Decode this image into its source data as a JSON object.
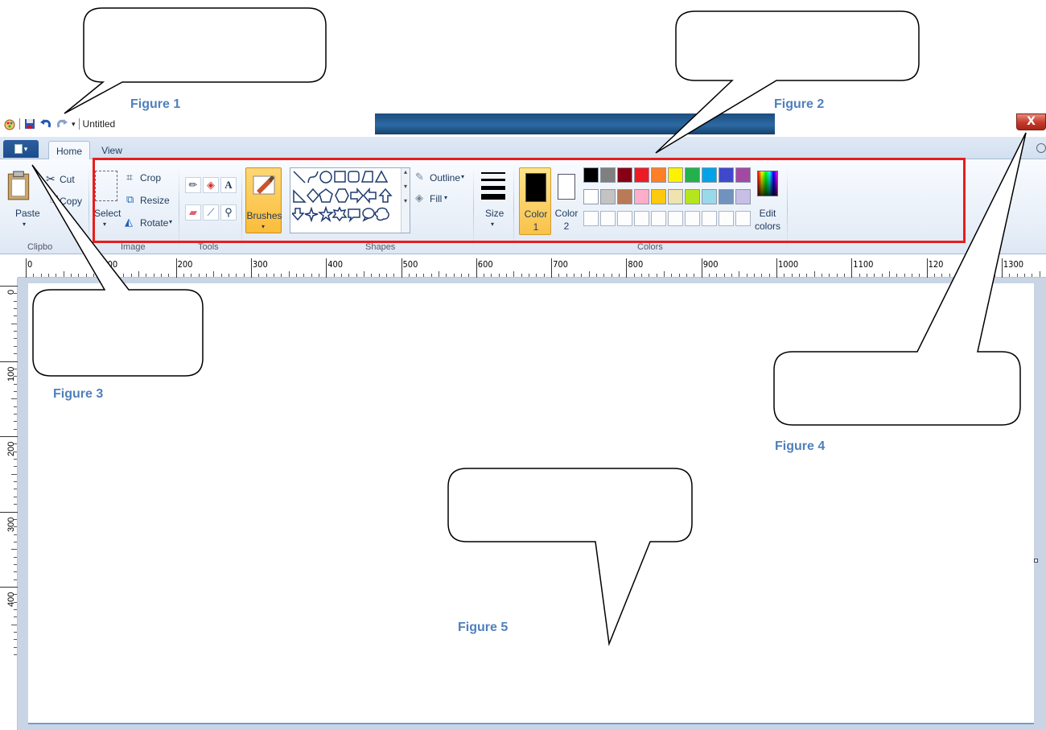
{
  "window": {
    "title_fragment": "Untitled",
    "close_label": "X"
  },
  "tabs": [
    {
      "label": "Home"
    },
    {
      "label": "View"
    }
  ],
  "ribbon": {
    "clipboard": {
      "group_label": "Clipbo",
      "paste": "Paste",
      "cut": "Cut",
      "copy": "Copy"
    },
    "image": {
      "group_label": "Image",
      "select": "Select",
      "crop": "Crop",
      "resize": "Resize",
      "rotate": "Rotate"
    },
    "tools": {
      "group_label": "Tools"
    },
    "brushes": {
      "label": "Brushes"
    },
    "shapes": {
      "group_label": "Shapes",
      "outline": "Outline",
      "fill": "Fill"
    },
    "size": {
      "label": "Size"
    },
    "colors": {
      "group_label": "Colors",
      "color1_line1": "Color",
      "color1_line2": "1",
      "color2_line1": "Color",
      "color2_line2": "2",
      "edit_line1": "Edit",
      "edit_line2": "colors",
      "row1": [
        "#000000",
        "#7f7f7f",
        "#880015",
        "#ed1c24",
        "#ff7f27",
        "#fff200",
        "#22b14c",
        "#00a2e8",
        "#3f48cc",
        "#a349a4"
      ],
      "row2": [
        "#ffffff",
        "#c3c3c3",
        "#b97a57",
        "#ffaec9",
        "#ffc90e",
        "#efe4b0",
        "#b5e61d",
        "#99d9ea",
        "#7092be",
        "#c8bfe7"
      ]
    }
  },
  "ruler": {
    "h_labels": [
      "0",
      "100",
      "200",
      "300",
      "400",
      "500",
      "600",
      "700",
      "800",
      "900",
      "1000",
      "1100",
      "120",
      "1300"
    ],
    "v_labels": [
      "0",
      "100",
      "200",
      "300",
      "400"
    ]
  },
  "figures": {
    "f1": "Figure 1",
    "f2": "Figure 2",
    "f3": "Figure 3",
    "f4": "Figure 4",
    "f5": "Figure 5"
  }
}
